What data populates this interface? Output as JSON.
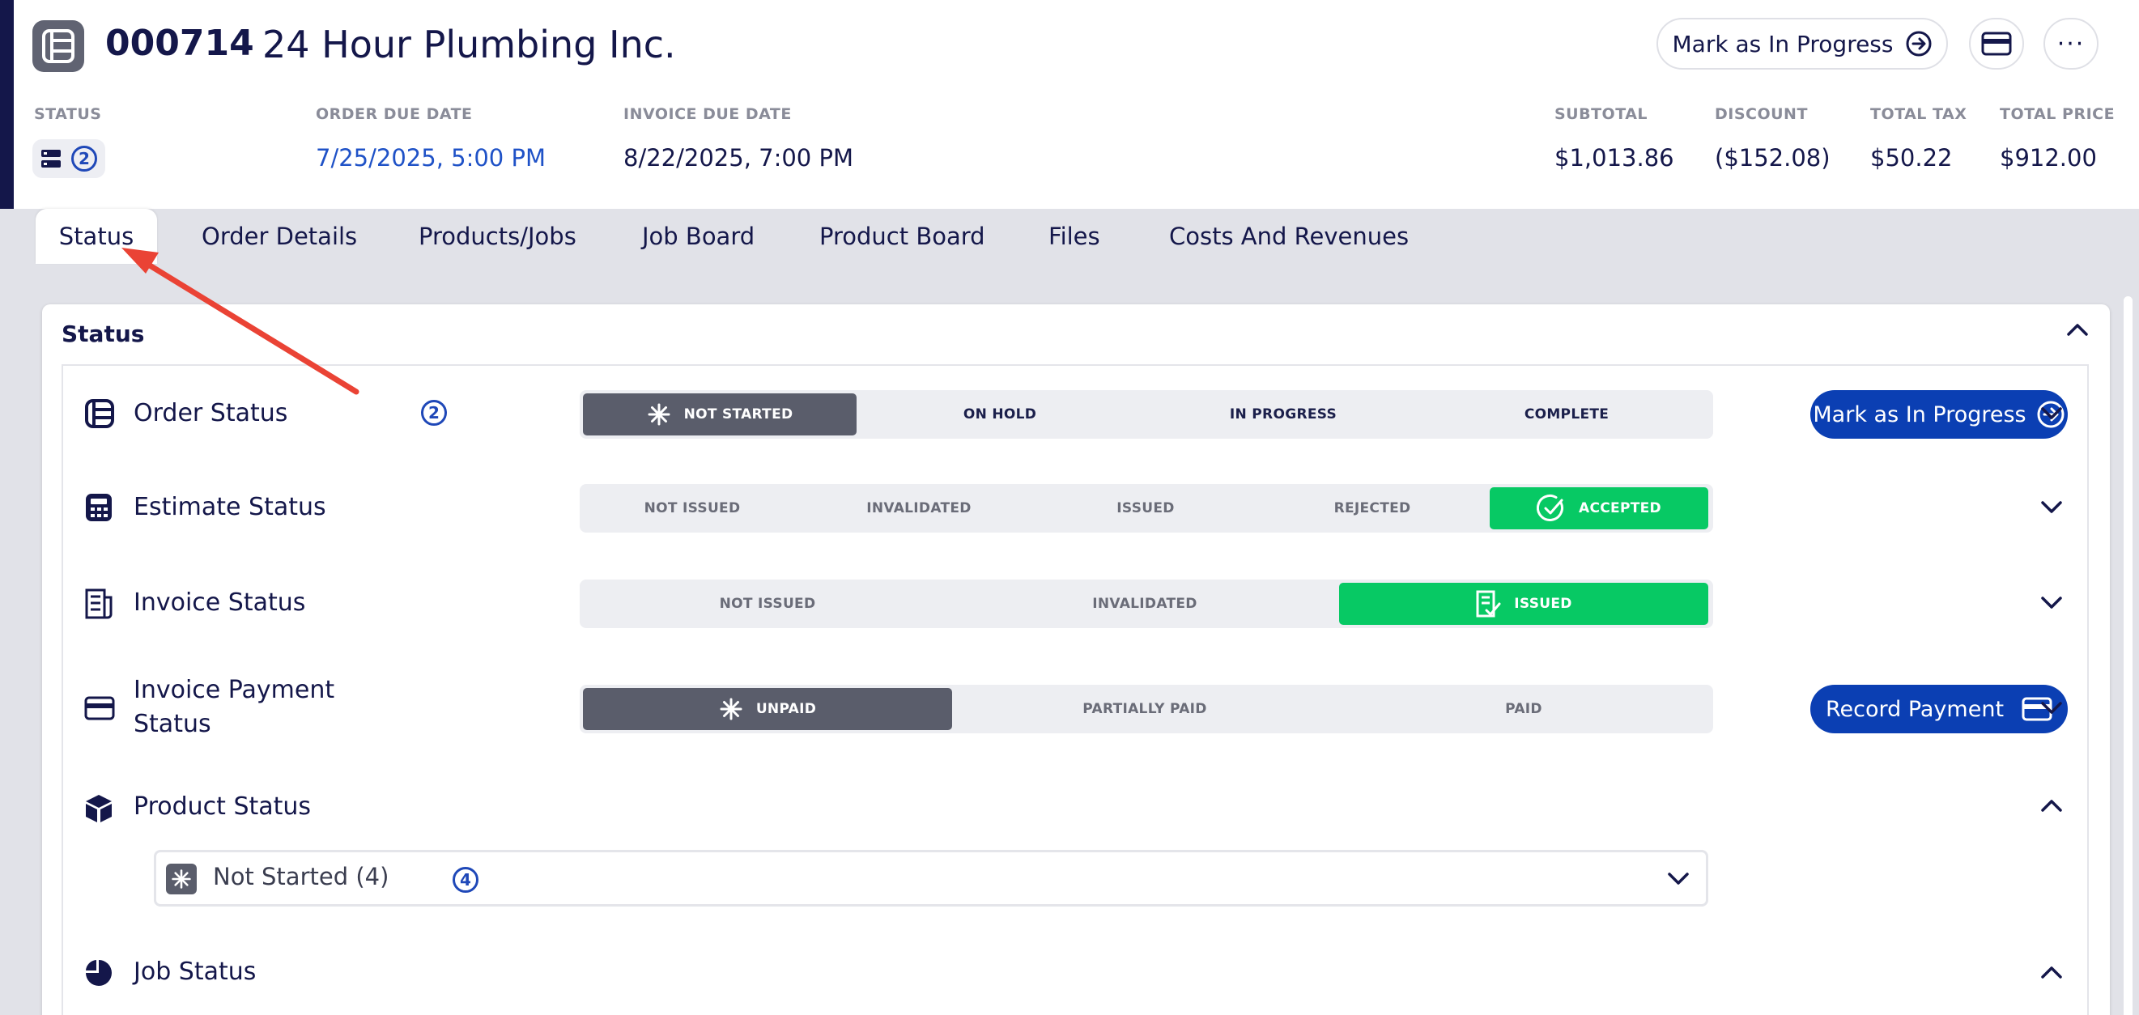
{
  "header": {
    "order_number": "000714",
    "customer_name": "24 Hour Plumbing Inc.",
    "mark_button_label": "Mark as In Progress",
    "more_label": "···",
    "status_label": "STATUS",
    "status_count": "2",
    "order_due_label": "ORDER DUE DATE",
    "order_due_value": "7/25/2025, 5:00 PM",
    "invoice_due_label": "INVOICE DUE DATE",
    "invoice_due_value": "8/22/2025, 7:00 PM",
    "subtotal_label": "SUBTOTAL",
    "subtotal_value": "$1,013.86",
    "discount_label": "DISCOUNT",
    "discount_value": "($152.08)",
    "tax_label": "TOTAL TAX",
    "tax_value": "$50.22",
    "total_label": "TOTAL PRICE",
    "total_value": "$912.00"
  },
  "tabs": [
    "Status",
    "Order Details",
    "Products/Jobs",
    "Job Board",
    "Product Board",
    "Files",
    "Costs And Revenues"
  ],
  "active_tab": "Status",
  "status_card": {
    "title": "Status",
    "order": {
      "title": "Order Status",
      "count": "2",
      "options": [
        "NOT STARTED",
        "ON HOLD",
        "IN PROGRESS",
        "COMPLETE"
      ],
      "selected": "NOT STARTED",
      "action_label": "Mark as In Progress"
    },
    "estimate": {
      "title": "Estimate Status",
      "options": [
        "NOT ISSUED",
        "INVALIDATED",
        "ISSUED",
        "REJECTED",
        "ACCEPTED"
      ],
      "selected": "ACCEPTED"
    },
    "invoice": {
      "title": "Invoice Status",
      "options": [
        "NOT ISSUED",
        "INVALIDATED",
        "ISSUED"
      ],
      "selected": "ISSUED"
    },
    "payment": {
      "title_line1": "Invoice Payment",
      "title_line2": "Status",
      "options": [
        "UNPAID",
        "PARTIALLY PAID",
        "PAID"
      ],
      "selected": "UNPAID",
      "action_label": "Record Payment"
    },
    "product": {
      "title": "Product Status",
      "dropdown_label": "Not Started (4)",
      "count": "4"
    },
    "job": {
      "title": "Job Status"
    }
  },
  "colors": {
    "navy": "#14174a",
    "primary_blue": "#0b3fb3",
    "link_blue": "#1f52c7",
    "success_green": "#07c964",
    "selected_dark": "#5a5d6b",
    "annotation_red": "#ea4335"
  },
  "icons": [
    "order-icon",
    "arrow-right-circle-icon",
    "credit-card-icon",
    "more-icon",
    "calculator-icon",
    "invoice-icon",
    "box-icon",
    "pie-chart-icon",
    "asterisk-icon",
    "check-circle-icon",
    "chevron-down-icon",
    "chevron-up-icon"
  ]
}
